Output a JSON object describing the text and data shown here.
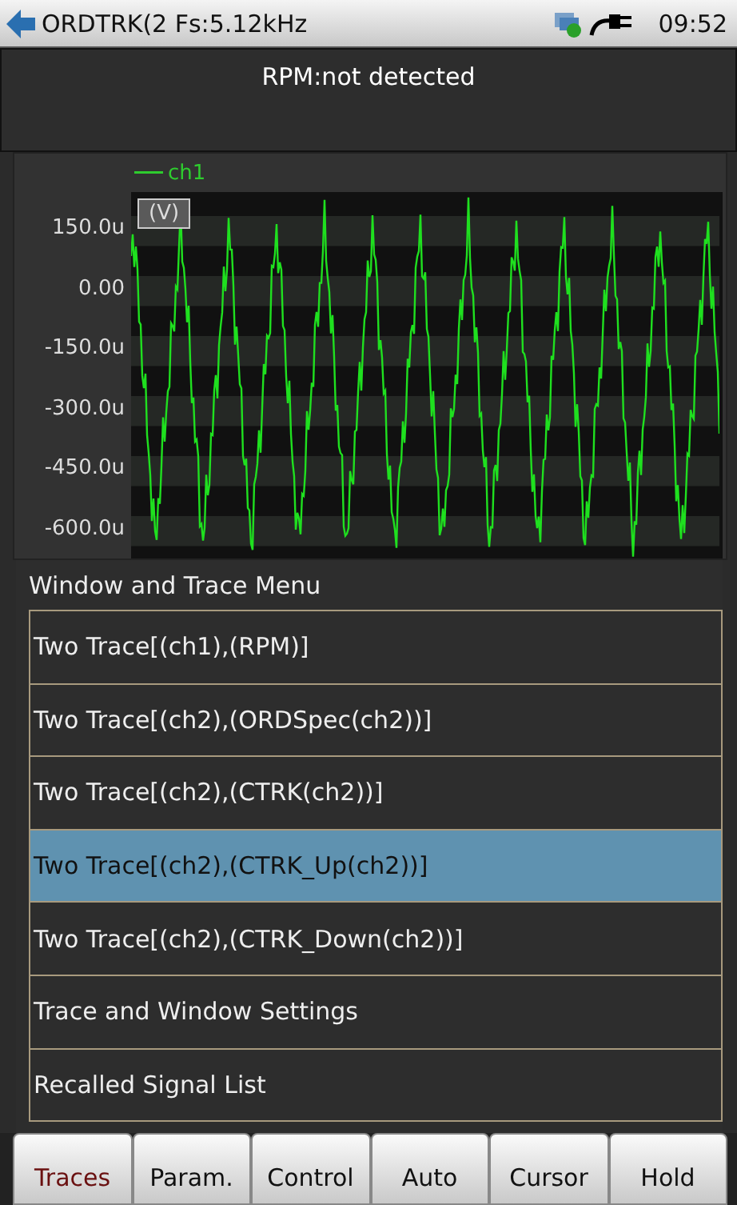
{
  "status_bar": {
    "title": "ORDTRK(2 Fs:5.12kHz",
    "time": "09:52"
  },
  "header": {
    "text": "RPM:not detected"
  },
  "chart": {
    "legend": "ch1",
    "unit": "(V)",
    "y_ticks": [
      "150.0u",
      "0.00",
      "-150.0u",
      "-300.0u",
      "-450.0u",
      "-600.0u"
    ]
  },
  "menu": {
    "title": "Window and Trace Menu",
    "items": [
      {
        "label": "Two Trace[(ch1),(RPM)]",
        "selected": false
      },
      {
        "label": "Two Trace[(ch2),(ORDSpec(ch2))]",
        "selected": false
      },
      {
        "label": "Two Trace[(ch2),(CTRK(ch2))]",
        "selected": false
      },
      {
        "label": "Two Trace[(ch2),(CTRK_Up(ch2))]",
        "selected": true
      },
      {
        "label": "Two Trace[(ch2),(CTRK_Down(ch2))]",
        "selected": false
      },
      {
        "label": "Trace and Window Settings",
        "selected": false
      },
      {
        "label": "Recalled Signal List",
        "selected": false
      }
    ]
  },
  "softkeys": [
    {
      "label": "Traces",
      "selected": true
    },
    {
      "label": "Param.",
      "selected": false
    },
    {
      "label": "Control",
      "selected": false
    },
    {
      "label": "Auto",
      "selected": false
    },
    {
      "label": "Cursor",
      "selected": false
    },
    {
      "label": "Hold",
      "selected": false
    }
  ]
}
